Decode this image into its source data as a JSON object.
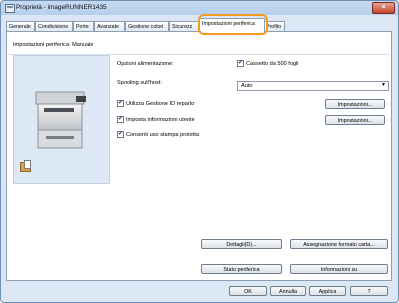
{
  "window": {
    "title": "Proprietà - imageRUNNER1435",
    "close_glyph": "×"
  },
  "tabs": [
    {
      "label": "Generale"
    },
    {
      "label": "Condivisione"
    },
    {
      "label": "Porte"
    },
    {
      "label": "Avanzate"
    },
    {
      "label": "Gestione colori"
    },
    {
      "label": "Sicurezz"
    },
    {
      "label": "Impostazioni periferica"
    },
    {
      "label": "Profilo"
    }
  ],
  "panel": {
    "device_setting": "Impostazioni periferica: Manuale",
    "power_options_label": "Opzioni alimentazione:",
    "cassette_label": "Cassetto da 500 fogli",
    "spooling_label": "Spooling sull'host:",
    "spooling_value": "Auto",
    "dept_id_label": "Utilizza Gestione ID reparto",
    "user_info_label": "Imposta informazioni utente",
    "secure_print_label": "Consenti uso stampa protetta",
    "settings_button_1": "Impostazioni...",
    "settings_button_2": "Impostazioni...",
    "details_button": "Dettagli(D)...",
    "paper_format_button": "Assegnazione formato carta...",
    "device_status_button": "Stato periferica",
    "info_button": "Informazioni su"
  },
  "footer": {
    "ok": "OK",
    "cancel": "Annulla",
    "apply": "Applica",
    "help": "?"
  }
}
